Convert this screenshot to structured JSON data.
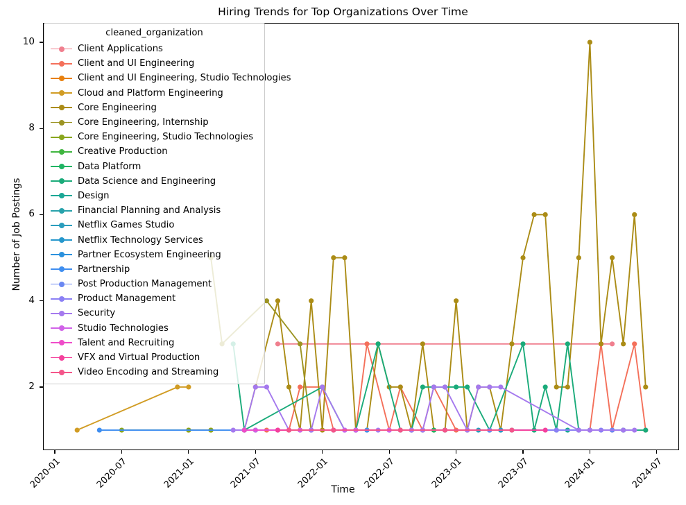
{
  "chart_data": {
    "type": "line",
    "title": "Hiring Trends for Top Organizations Over Time",
    "xlabel": "Time",
    "ylabel": "Number of Job Postings",
    "legend_title": "cleaned_organization",
    "legend_position": "upper left",
    "grid": false,
    "markers": "circle",
    "xlim": [
      "2019-12",
      "2024-09"
    ],
    "ylim": [
      0.55,
      10.45
    ],
    "yticks": [
      2,
      4,
      6,
      8,
      10
    ],
    "xticks": [
      "2020-01",
      "2020-07",
      "2021-01",
      "2021-07",
      "2022-01",
      "2022-07",
      "2023-01",
      "2023-07",
      "2024-01",
      "2024-07"
    ],
    "series": [
      {
        "name": "Client Applications",
        "color": "#f07f8e",
        "x": [
          "2021-09",
          "2024-03"
        ],
        "values": [
          3,
          3
        ]
      },
      {
        "name": "Client and UI Engineering",
        "color": "#f4705a",
        "x": [
          "2021-08",
          "2021-10",
          "2021-11",
          "2022-01",
          "2022-02",
          "2022-04",
          "2022-05",
          "2022-07",
          "2022-08",
          "2022-10",
          "2022-11",
          "2023-01",
          "2023-02",
          "2023-04",
          "2024-01",
          "2024-02",
          "2024-03",
          "2024-05",
          "2024-06"
        ],
        "values": [
          1,
          1,
          2,
          2,
          1,
          1,
          3,
          1,
          2,
          1,
          2,
          1,
          1,
          1,
          1,
          3,
          1,
          3,
          1
        ]
      },
      {
        "name": "Client and UI Engineering, Studio Technologies",
        "color": "#e8800e",
        "x": [
          "2021-01",
          "2021-03"
        ],
        "values": [
          1,
          1
        ]
      },
      {
        "name": "Cloud and Platform Engineering",
        "color": "#d19c24",
        "x": [
          "2020-03",
          "2020-12",
          "2021-01"
        ],
        "values": [
          1,
          2,
          2
        ]
      },
      {
        "name": "Core Engineering",
        "color": "#ab8c16",
        "x": [
          "2021-06",
          "2021-07",
          "2021-09",
          "2021-10",
          "2021-11",
          "2021-12",
          "2022-01",
          "2022-02",
          "2022-03",
          "2022-04",
          "2022-05",
          "2022-06",
          "2022-07",
          "2022-08",
          "2022-09",
          "2022-10",
          "2022-11",
          "2022-12",
          "2023-01",
          "2023-02",
          "2023-03",
          "2023-04",
          "2023-05",
          "2023-06",
          "2023-07",
          "2023-08",
          "2023-09",
          "2023-10",
          "2023-11",
          "2023-12",
          "2024-01",
          "2024-02",
          "2024-03",
          "2024-04",
          "2024-05",
          "2024-06"
        ],
        "values": [
          1,
          2,
          4,
          2,
          1,
          4,
          1,
          5,
          5,
          1,
          1,
          3,
          2,
          2,
          1,
          3,
          1,
          1,
          4,
          1,
          2,
          2,
          1,
          3,
          5,
          6,
          6,
          2,
          2,
          5,
          10,
          3,
          5,
          3,
          6,
          2
        ]
      },
      {
        "name": "Core Engineering, Internship",
        "color": "#9c9423",
        "x": [
          "2021-03",
          "2021-04",
          "2021-08",
          "2021-11",
          "2021-12"
        ],
        "values": [
          5,
          3,
          4,
          3,
          1
        ]
      },
      {
        "name": "Core Engineering, Studio Technologies",
        "color": "#89a61d",
        "x": [
          "2020-07",
          "2021-01",
          "2021-03"
        ],
        "values": [
          1,
          1,
          1
        ]
      },
      {
        "name": "Creative Production",
        "color": "#3fb53f",
        "x": [
          "2021-06",
          "2021-07"
        ],
        "values": [
          1,
          1
        ]
      },
      {
        "name": "Data Platform",
        "color": "#20b463",
        "x": [
          "2022-10",
          "2022-11"
        ],
        "values": [
          1,
          1
        ]
      },
      {
        "name": "Data Science and Engineering",
        "color": "#1aab7a",
        "x": [
          "2021-05",
          "2021-06",
          "2022-01",
          "2022-03",
          "2022-04",
          "2022-06",
          "2022-08",
          "2022-09",
          "2022-10",
          "2022-11",
          "2022-12",
          "2023-01",
          "2023-02",
          "2023-04",
          "2023-07",
          "2023-08",
          "2023-09",
          "2023-10",
          "2023-11",
          "2023-12",
          "2024-01",
          "2024-06"
        ],
        "values": [
          3,
          1,
          2,
          1,
          1,
          3,
          1,
          1,
          2,
          2,
          2,
          2,
          2,
          1,
          3,
          1,
          2,
          1,
          3,
          1,
          1,
          1
        ]
      },
      {
        "name": "Design",
        "color": "#1aa795",
        "x": [
          "2023-11",
          "2024-04"
        ],
        "values": [
          1,
          1
        ]
      },
      {
        "name": "Financial Planning and Analysis",
        "color": "#27a2ab",
        "x": [
          "2023-06",
          "2024-04"
        ],
        "values": [
          1,
          1
        ]
      },
      {
        "name": "Netflix Games Studio",
        "color": "#2a9dbd",
        "x": [
          "2022-09",
          "2023-03"
        ],
        "values": [
          1,
          1
        ]
      },
      {
        "name": "Netflix Technology Services",
        "color": "#2597cc",
        "x": [
          "2023-05",
          "2023-12"
        ],
        "values": [
          1,
          1
        ]
      },
      {
        "name": "Partner Ecosystem Engineering",
        "color": "#2b91dd",
        "x": [
          "2021-12",
          "2022-12"
        ],
        "values": [
          1,
          1
        ]
      },
      {
        "name": "Partnership",
        "color": "#3f8ef0",
        "x": [
          "2020-05",
          "2022-05"
        ],
        "values": [
          1,
          1
        ]
      },
      {
        "name": "Post Production Management",
        "color": "#6a87f2",
        "x": [
          "2023-04",
          "2024-03"
        ],
        "values": [
          1,
          1
        ]
      },
      {
        "name": "Product Management",
        "color": "#8b80f5",
        "x": [
          "2022-02",
          "2023-10",
          "2024-02"
        ],
        "values": [
          1,
          1,
          1
        ]
      },
      {
        "name": "Security",
        "color": "#a579ee",
        "x": [
          "2021-05",
          "2021-06",
          "2021-07",
          "2021-08",
          "2021-10",
          "2021-12",
          "2022-01",
          "2022-03",
          "2022-04",
          "2022-06",
          "2022-07",
          "2022-09",
          "2022-10",
          "2022-11",
          "2022-12",
          "2023-02",
          "2023-03",
          "2023-04",
          "2023-05",
          "2023-12",
          "2024-01",
          "2024-04",
          "2024-05"
        ],
        "values": [
          1,
          1,
          2,
          2,
          1,
          1,
          2,
          1,
          1,
          1,
          1,
          1,
          1,
          2,
          2,
          1,
          2,
          2,
          2,
          1,
          1,
          1,
          1
        ]
      },
      {
        "name": "Studio Technologies",
        "color": "#d062e8",
        "x": [
          "2021-07",
          "2021-11",
          "2022-03",
          "2022-04",
          "2022-07"
        ],
        "values": [
          1,
          1,
          1,
          1,
          1
        ]
      },
      {
        "name": "Talent and Recruiting",
        "color": "#ef4cc9",
        "x": [
          "2021-06",
          "2021-09"
        ],
        "values": [
          1,
          1
        ]
      },
      {
        "name": "VFX and Virtual Production",
        "color": "#f4419c",
        "x": [
          "2021-09",
          "2023-09"
        ],
        "values": [
          1,
          1
        ]
      },
      {
        "name": "Video Encoding and Streaming",
        "color": "#f4558a",
        "x": [
          "2021-10",
          "2022-02",
          "2022-08",
          "2022-12",
          "2023-06"
        ],
        "values": [
          1,
          1,
          1,
          1,
          1
        ]
      }
    ]
  }
}
